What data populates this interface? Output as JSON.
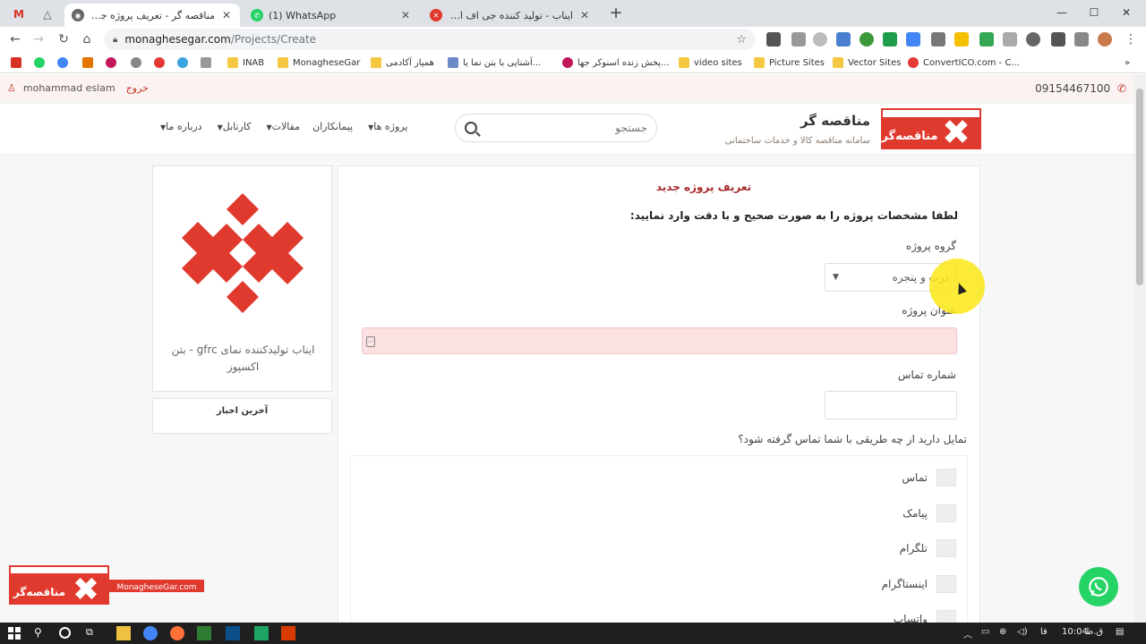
{
  "browser": {
    "tabs": [
      {
        "title": "مناقصه گر - تعریف پروژه جدید",
        "active": true
      },
      {
        "title": "(1) WhatsApp",
        "active": false
      },
      {
        "title": "ایناب - تولید کننده جی اف ار سی",
        "active": false
      }
    ],
    "url_host": "monaghesegar.com",
    "url_path": "/Projects/Create",
    "bookmarks": [
      "INAB",
      "MonagheseGar",
      "همیار آکادمی",
      "آشنایی با بتن نما یا...",
      "پخش زنده اسنوکر جها...",
      "video sites",
      "Picture Sites",
      "Vector Sites",
      "ConvertICO.com - C..."
    ]
  },
  "topbar": {
    "username": "mohammad eslam",
    "logout": "خروج",
    "phone": "09154467100"
  },
  "header": {
    "brand_title": "مناقصه گر",
    "brand_subtitle": "سامانه مناقصه کالا و خدمات ساختمانی",
    "search_placeholder": "جستجو",
    "nav": [
      {
        "label": "پروژه ها",
        "dropdown": true
      },
      {
        "label": "پیمانکاران",
        "dropdown": false
      },
      {
        "label": "مقالات",
        "dropdown": true
      },
      {
        "label": "کارتابل",
        "dropdown": true
      },
      {
        "label": "درباره ما",
        "dropdown": true
      }
    ]
  },
  "sidebar": {
    "company_caption": "ایناب تولیدکننده نمای gfrc - بتن اکسپوز",
    "news_title": "آخرین اخبار"
  },
  "form": {
    "title": "تعریف پروژه جدید",
    "intro": "لطفا مشخصات پروژه را به صورت صحیح و با دقت وارد نمایید:",
    "group_label": "گروه پروژه",
    "group_value": "درب و پنجره",
    "title_label": "عنوان پروژه",
    "phone_label": "شماره تماس",
    "contact_question": "تمایل دارید از چه طریقی با شما تماس گرفته شود؟",
    "contact_methods": [
      "تماس",
      "پیامک",
      "تلگرام",
      "اینستاگرام",
      "واتساپ"
    ]
  },
  "watermark": {
    "site": "MonagheseGar.com"
  },
  "taskbar": {
    "time": "10:04",
    "ampm": "ق.ظ",
    "lang": "فا"
  },
  "colors": {
    "brand_red": "#e03a2f",
    "title_red": "#a52a2a",
    "error_bg": "#fbe1e1"
  }
}
